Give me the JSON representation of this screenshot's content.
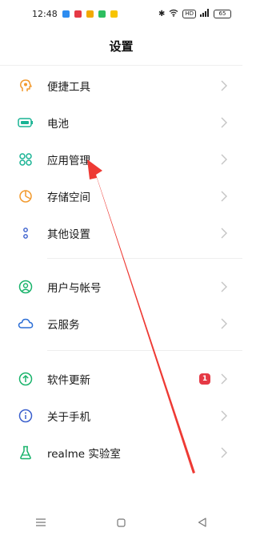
{
  "status": {
    "time": "12:48",
    "network_badge": "HD",
    "battery": "65",
    "app_colors": [
      "#2d8cf0",
      "#e53945",
      "#f2a900",
      "#2dbe60",
      "#f7c400"
    ]
  },
  "page": {
    "title": "设置"
  },
  "groups": [
    [
      {
        "label": "便捷工具",
        "icon": "smart-assist-icon",
        "color": "#f29a2e"
      },
      {
        "label": "电池",
        "icon": "battery-icon",
        "color": "#19b394"
      },
      {
        "label": "应用管理",
        "icon": "app-grid-icon",
        "color": "#19b394"
      },
      {
        "label": "存储空间",
        "icon": "storage-icon",
        "color": "#f29a2e"
      },
      {
        "label": "其他设置",
        "icon": "more-settings-icon",
        "color": "#3a5fcd"
      }
    ],
    [
      {
        "label": "用户与帐号",
        "icon": "account-icon",
        "color": "#19b36b"
      },
      {
        "label": "云服务",
        "icon": "cloud-icon",
        "color": "#2d6fd6"
      }
    ],
    [
      {
        "label": "软件更新",
        "icon": "update-icon",
        "color": "#19b36b",
        "badge": "1"
      },
      {
        "label": "关于手机",
        "icon": "info-icon",
        "color": "#3a5fcd"
      },
      {
        "label": "realme 实验室",
        "icon": "lab-flask-icon",
        "color": "#19b36b"
      }
    ]
  ],
  "accent_arrow_color": "#ee3a34"
}
